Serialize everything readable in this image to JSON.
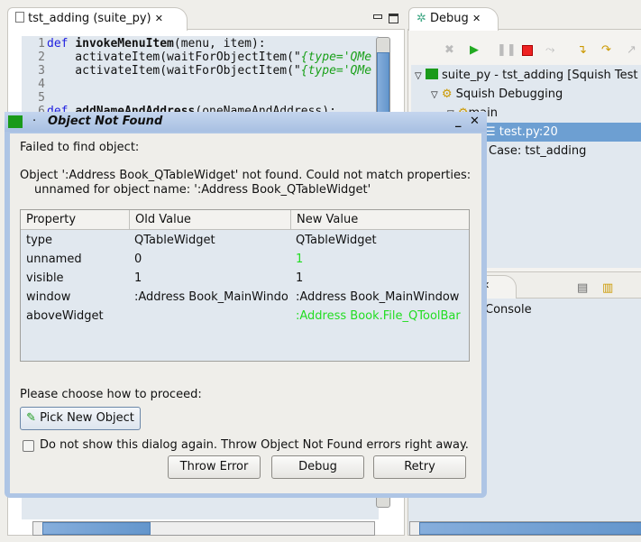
{
  "editor": {
    "tab_title": "tst_adding (suite_py)",
    "lines": [
      {
        "n": "1",
        "parts": [
          [
            "kw",
            "def "
          ],
          [
            "fn",
            "invokeMenuItem"
          ],
          [
            "",
            "(menu, item):"
          ]
        ]
      },
      {
        "n": "2",
        "parts": [
          [
            "",
            "    activateItem(waitForObjectItem(\""
          ],
          [
            "str",
            "{type='QMe"
          ]
        ]
      },
      {
        "n": "3",
        "parts": [
          [
            "",
            "    activateItem(waitForObjectItem(\""
          ],
          [
            "str",
            "{type='QMe"
          ]
        ]
      },
      {
        "n": "4",
        "parts": []
      },
      {
        "n": "5",
        "parts": []
      },
      {
        "n": "6",
        "parts": [
          [
            "kw",
            "def "
          ],
          [
            "fn",
            "addNameAndAddress"
          ],
          [
            "",
            "(oneNameAndAddress):"
          ]
        ]
      }
    ]
  },
  "debug": {
    "tab_title": "Debug",
    "tree": [
      "suite_py - tst_adding [Squish Test",
      "Squish Debugging",
      "main",
      "test.py:20",
      "Case: tst_adding"
    ],
    "console_label": "Console"
  },
  "dialog": {
    "title": "Object Not Found",
    "message1": "Failed to find object:",
    "message2": "Object ':Address Book_QTableWidget' not found. Could not match properties:",
    "message3": "unnamed for object name: ':Address Book_QTableWidget'",
    "columns": [
      "Property",
      "Old Value",
      "New Value"
    ],
    "rows": [
      {
        "property": "type",
        "old": "QTableWidget",
        "new": "QTableWidget",
        "changed": false
      },
      {
        "property": "unnamed",
        "old": "0",
        "new": "1",
        "changed": true
      },
      {
        "property": "visible",
        "old": "1",
        "new": "1",
        "changed": false
      },
      {
        "property": "window",
        "old": ":Address Book_MainWindo",
        "new": ":Address Book_MainWindow",
        "changed": false
      },
      {
        "property": "aboveWidget",
        "old": "",
        "new": ":Address Book.File_QToolBar",
        "changed": true
      }
    ],
    "proceed_label": "Please choose how to proceed:",
    "pick_button": "Pick New Object",
    "checkbox_label": "Do not show this dialog again. Throw Object Not Found errors right away.",
    "checkbox_checked": false,
    "buttons": {
      "throw": "Throw Error",
      "debug": "Debug",
      "retry": "Retry"
    },
    "changed_color": "#22dd22"
  }
}
